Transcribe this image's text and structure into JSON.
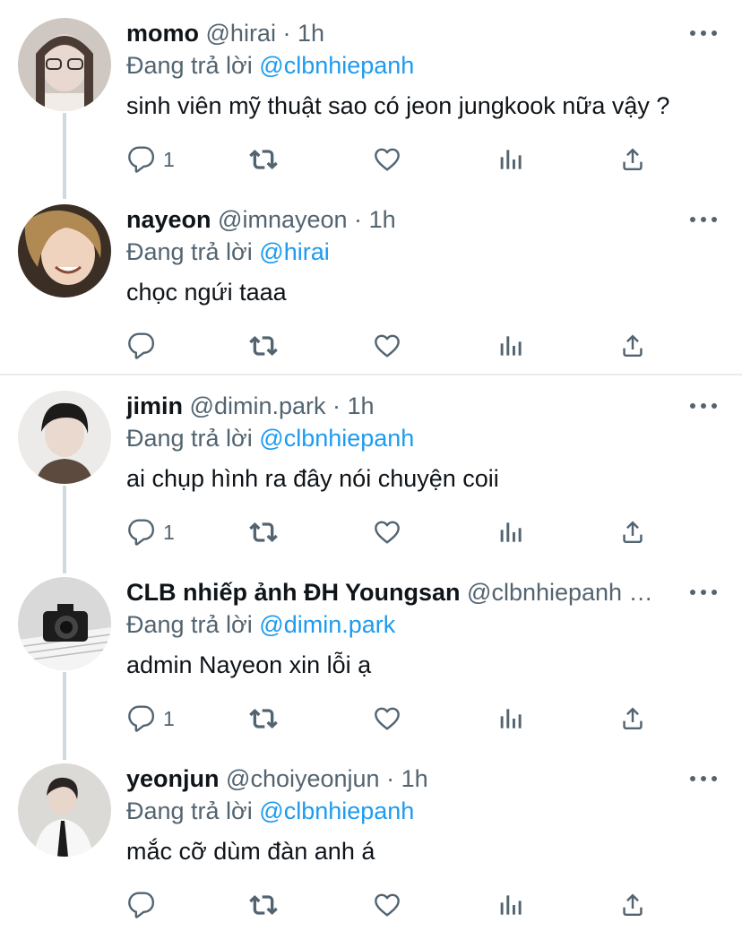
{
  "icons": {
    "reply": "reply-icon",
    "retweet": "retweet-icon",
    "like": "heart-icon",
    "views": "analytics-icon",
    "share": "share-icon",
    "more": "more-icon"
  },
  "colors": {
    "mention": "#1d9bf0",
    "secondary_text": "#536471",
    "thread_line": "#cfd9de"
  },
  "tweets": [
    {
      "name": "momo",
      "handle": "@hirai",
      "separator": "·",
      "time": "1h",
      "replying_prefix": "Đang trả lời",
      "replying_to": "@clbnhiepanh",
      "text": "sinh viên mỹ thuật sao có jeon jungkook nữa vậy ?",
      "reply_count": "1"
    },
    {
      "name": "nayeon",
      "handle": "@imnayeon",
      "separator": "·",
      "time": "1h",
      "replying_prefix": "Đang trả lời",
      "replying_to": "@hirai",
      "text": "chọc ngứi taaa",
      "reply_count": ""
    },
    {
      "name": "jimin",
      "handle": "@dimin.park",
      "separator": "·",
      "time": "1h",
      "replying_prefix": "Đang trả lời",
      "replying_to": "@clbnhiepanh",
      "text": "ai chụp hình ra đây nói chuyện coii",
      "reply_count": "1"
    },
    {
      "name": "CLB nhiếp ảnh ĐH Youngsan",
      "handle": "@clbnhiepanh …",
      "separator": "",
      "time": "",
      "replying_prefix": "Đang trả lời",
      "replying_to": "@dimin.park",
      "text": "admin Nayeon xin lỗi ạ",
      "reply_count": "1"
    },
    {
      "name": "yeonjun",
      "handle": "@choiyeonjun",
      "separator": "·",
      "time": "1h",
      "replying_prefix": "Đang trả lời",
      "replying_to": "@clbnhiepanh",
      "text": "mắc cỡ dùm đàn anh á",
      "reply_count": ""
    }
  ]
}
